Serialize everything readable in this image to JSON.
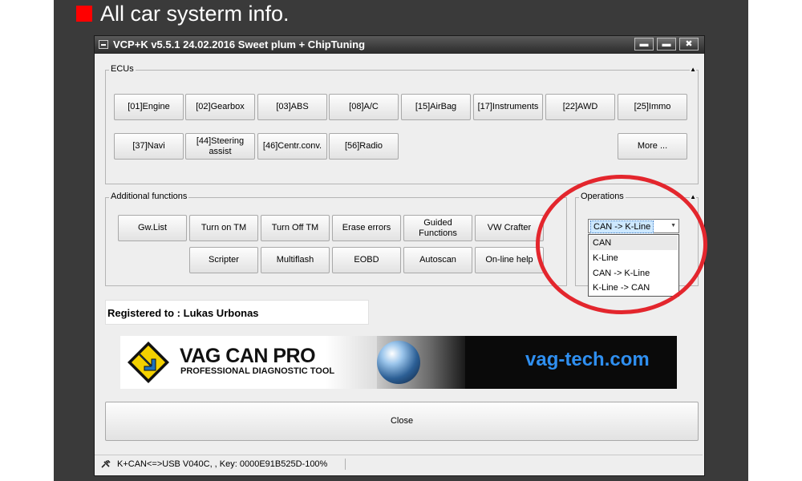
{
  "slide": {
    "title": "All car systerm info."
  },
  "window": {
    "title": "VCP+K v5.5.1 24.02.2016 Sweet plum + ChipTuning",
    "controls": {
      "minimize": "▬",
      "maximize": "▬",
      "close": "✖"
    }
  },
  "ecus": {
    "label": "ECUs",
    "row1": [
      "[01]Engine",
      "[02]Gearbox",
      "[03]ABS",
      "[08]A/C",
      "[15]AirBag",
      "[17]Instruments",
      "[22]AWD",
      "[25]Immo"
    ],
    "row2": [
      "[37]Navi",
      "[44]Steering assist",
      "[46]Centr.conv.",
      "[56]Radio"
    ],
    "more": "More ..."
  },
  "additional": {
    "label": "Additional functions",
    "row1": [
      "Gw.List",
      "Turn on TM",
      "Turn Off TM",
      "Erase errors",
      "Guided Functions",
      "VW Crafter"
    ],
    "row2": [
      "Scripter",
      "Multiflash",
      "EOBD",
      "Autoscan",
      "On-line help"
    ]
  },
  "operations": {
    "label": "Operations",
    "selected": "CAN -> K-Line",
    "options": [
      "CAN",
      "K-Line",
      "CAN -> K-Line",
      "K-Line -> CAN"
    ]
  },
  "registered": "Registered to : Lukas Urbonas",
  "banner": {
    "brand": "VAG CAN PRO",
    "tagline": "PROFESSIONAL DIAGNOSTIC TOOL",
    "site": "vag-tech.com"
  },
  "close_label": "Close",
  "status": "K+CAN<=>USB V040C, , Key: 0000E91B525D-100%",
  "colors": {
    "annotation": "#e3262d",
    "bullet": "#ff0000",
    "site": "#2f8ff0"
  }
}
